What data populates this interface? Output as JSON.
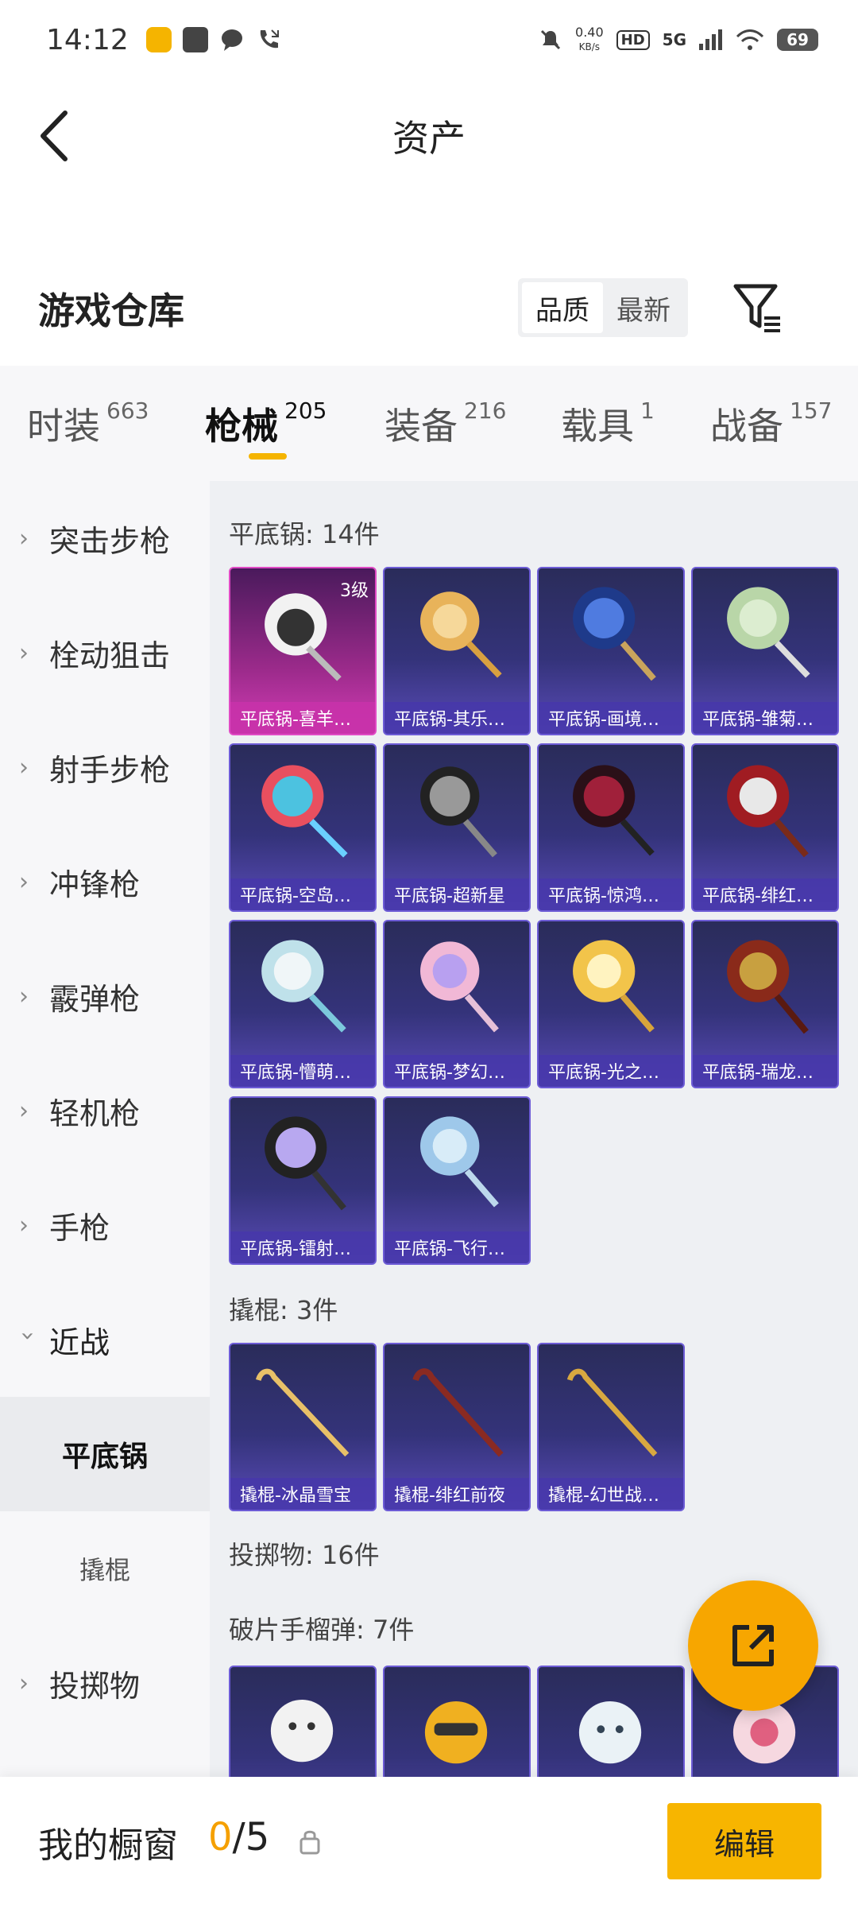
{
  "status_bar": {
    "time": "14:12",
    "net_speed_value": "0.40",
    "net_speed_unit": "KB/s",
    "hd_label": "HD",
    "signal_label": "5G",
    "battery": "69"
  },
  "header": {
    "title": "资产"
  },
  "warehouse": {
    "title": "游戏仓库",
    "sort_options": [
      "品质",
      "最新"
    ],
    "sort_selected": "品质"
  },
  "tabs": [
    {
      "label": "时装",
      "count": "663"
    },
    {
      "label": "枪械",
      "count": "205",
      "active": true
    },
    {
      "label": "装备",
      "count": "216"
    },
    {
      "label": "载具",
      "count": "1"
    },
    {
      "label": "战备",
      "count": "157"
    }
  ],
  "sidebar": {
    "items": [
      {
        "label": "突击步枪"
      },
      {
        "label": "栓动狙击"
      },
      {
        "label": "射手步枪"
      },
      {
        "label": "冲锋枪"
      },
      {
        "label": "霰弹枪"
      },
      {
        "label": "轻机枪"
      },
      {
        "label": "手枪"
      },
      {
        "label": "近战"
      }
    ],
    "sub_items": [
      {
        "label": "平底锅",
        "active": true
      },
      {
        "label": "撬棍"
      }
    ],
    "after_item": "投掷物"
  },
  "content": {
    "sections": [
      {
        "title": "平底锅: 14件",
        "items": [
          {
            "label": "平底锅-喜羊…",
            "level": "3级"
          },
          {
            "label": "平底锅-其乐…"
          },
          {
            "label": "平底锅-画境…"
          },
          {
            "label": "平底锅-雏菊…"
          },
          {
            "label": "平底锅-空岛…"
          },
          {
            "label": "平底锅-超新星"
          },
          {
            "label": "平底锅-惊鸿…"
          },
          {
            "label": "平底锅-绯红…"
          },
          {
            "label": "平底锅-懵萌…"
          },
          {
            "label": "平底锅-梦幻…"
          },
          {
            "label": "平底锅-光之…"
          },
          {
            "label": "平底锅-瑞龙…"
          },
          {
            "label": "平底锅-镭射…"
          },
          {
            "label": "平底锅-飞行…"
          }
        ]
      },
      {
        "title": "撬棍: 3件",
        "items": [
          {
            "label": "撬棍-冰晶雪宝"
          },
          {
            "label": "撬棍-绯红前夜"
          },
          {
            "label": "撬棍-幻世战…"
          }
        ]
      },
      {
        "title": "投掷物: 16件",
        "items": []
      },
      {
        "title": "破片手榴弹: 7件",
        "items": []
      }
    ]
  },
  "bottom": {
    "showcase_title": "我的橱窗",
    "showcase_current": "0",
    "showcase_max": "/5",
    "edit_label": "编辑"
  },
  "colors": {
    "accent": "#f7b500",
    "card_purple": "#34337a",
    "card_pink": "#d23cb4"
  },
  "icons": [
    "back-arrow-icon",
    "filter-icon",
    "chevron-right-icon",
    "chevron-down-icon",
    "lock-icon",
    "share-icon"
  ]
}
